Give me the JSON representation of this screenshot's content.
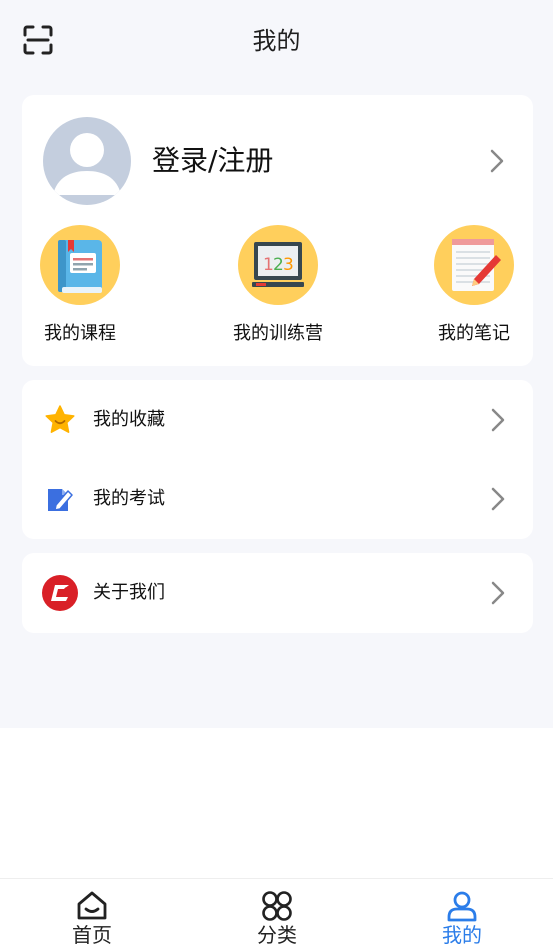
{
  "header": {
    "title": "我的",
    "scan_icon": "scan-icon"
  },
  "profile": {
    "login_label": "登录/注册",
    "avatar_icon": "default-avatar-icon"
  },
  "shortcuts": [
    {
      "label": "我的课程",
      "icon": "book-icon"
    },
    {
      "label": "我的训练营",
      "icon": "blackboard-123-icon"
    },
    {
      "label": "我的笔记",
      "icon": "notepad-pencil-icon"
    }
  ],
  "menu": [
    {
      "label": "我的收藏",
      "icon": "star-icon"
    },
    {
      "label": "我的考试",
      "icon": "exam-edit-icon"
    }
  ],
  "about": {
    "label": "关于我们",
    "icon": "brand-logo-icon"
  },
  "tabbar": [
    {
      "label": "首页",
      "icon": "home-icon",
      "active": false
    },
    {
      "label": "分类",
      "icon": "category-icon",
      "active": false
    },
    {
      "label": "我的",
      "icon": "user-icon",
      "active": true
    }
  ],
  "colors": {
    "accent": "#2b7de9",
    "shortcut_bg": "#ffcf5c",
    "page_bg": "#f6f7fb",
    "star": "#ffb300",
    "exam": "#3b6fe0",
    "brand": "#d92027"
  }
}
